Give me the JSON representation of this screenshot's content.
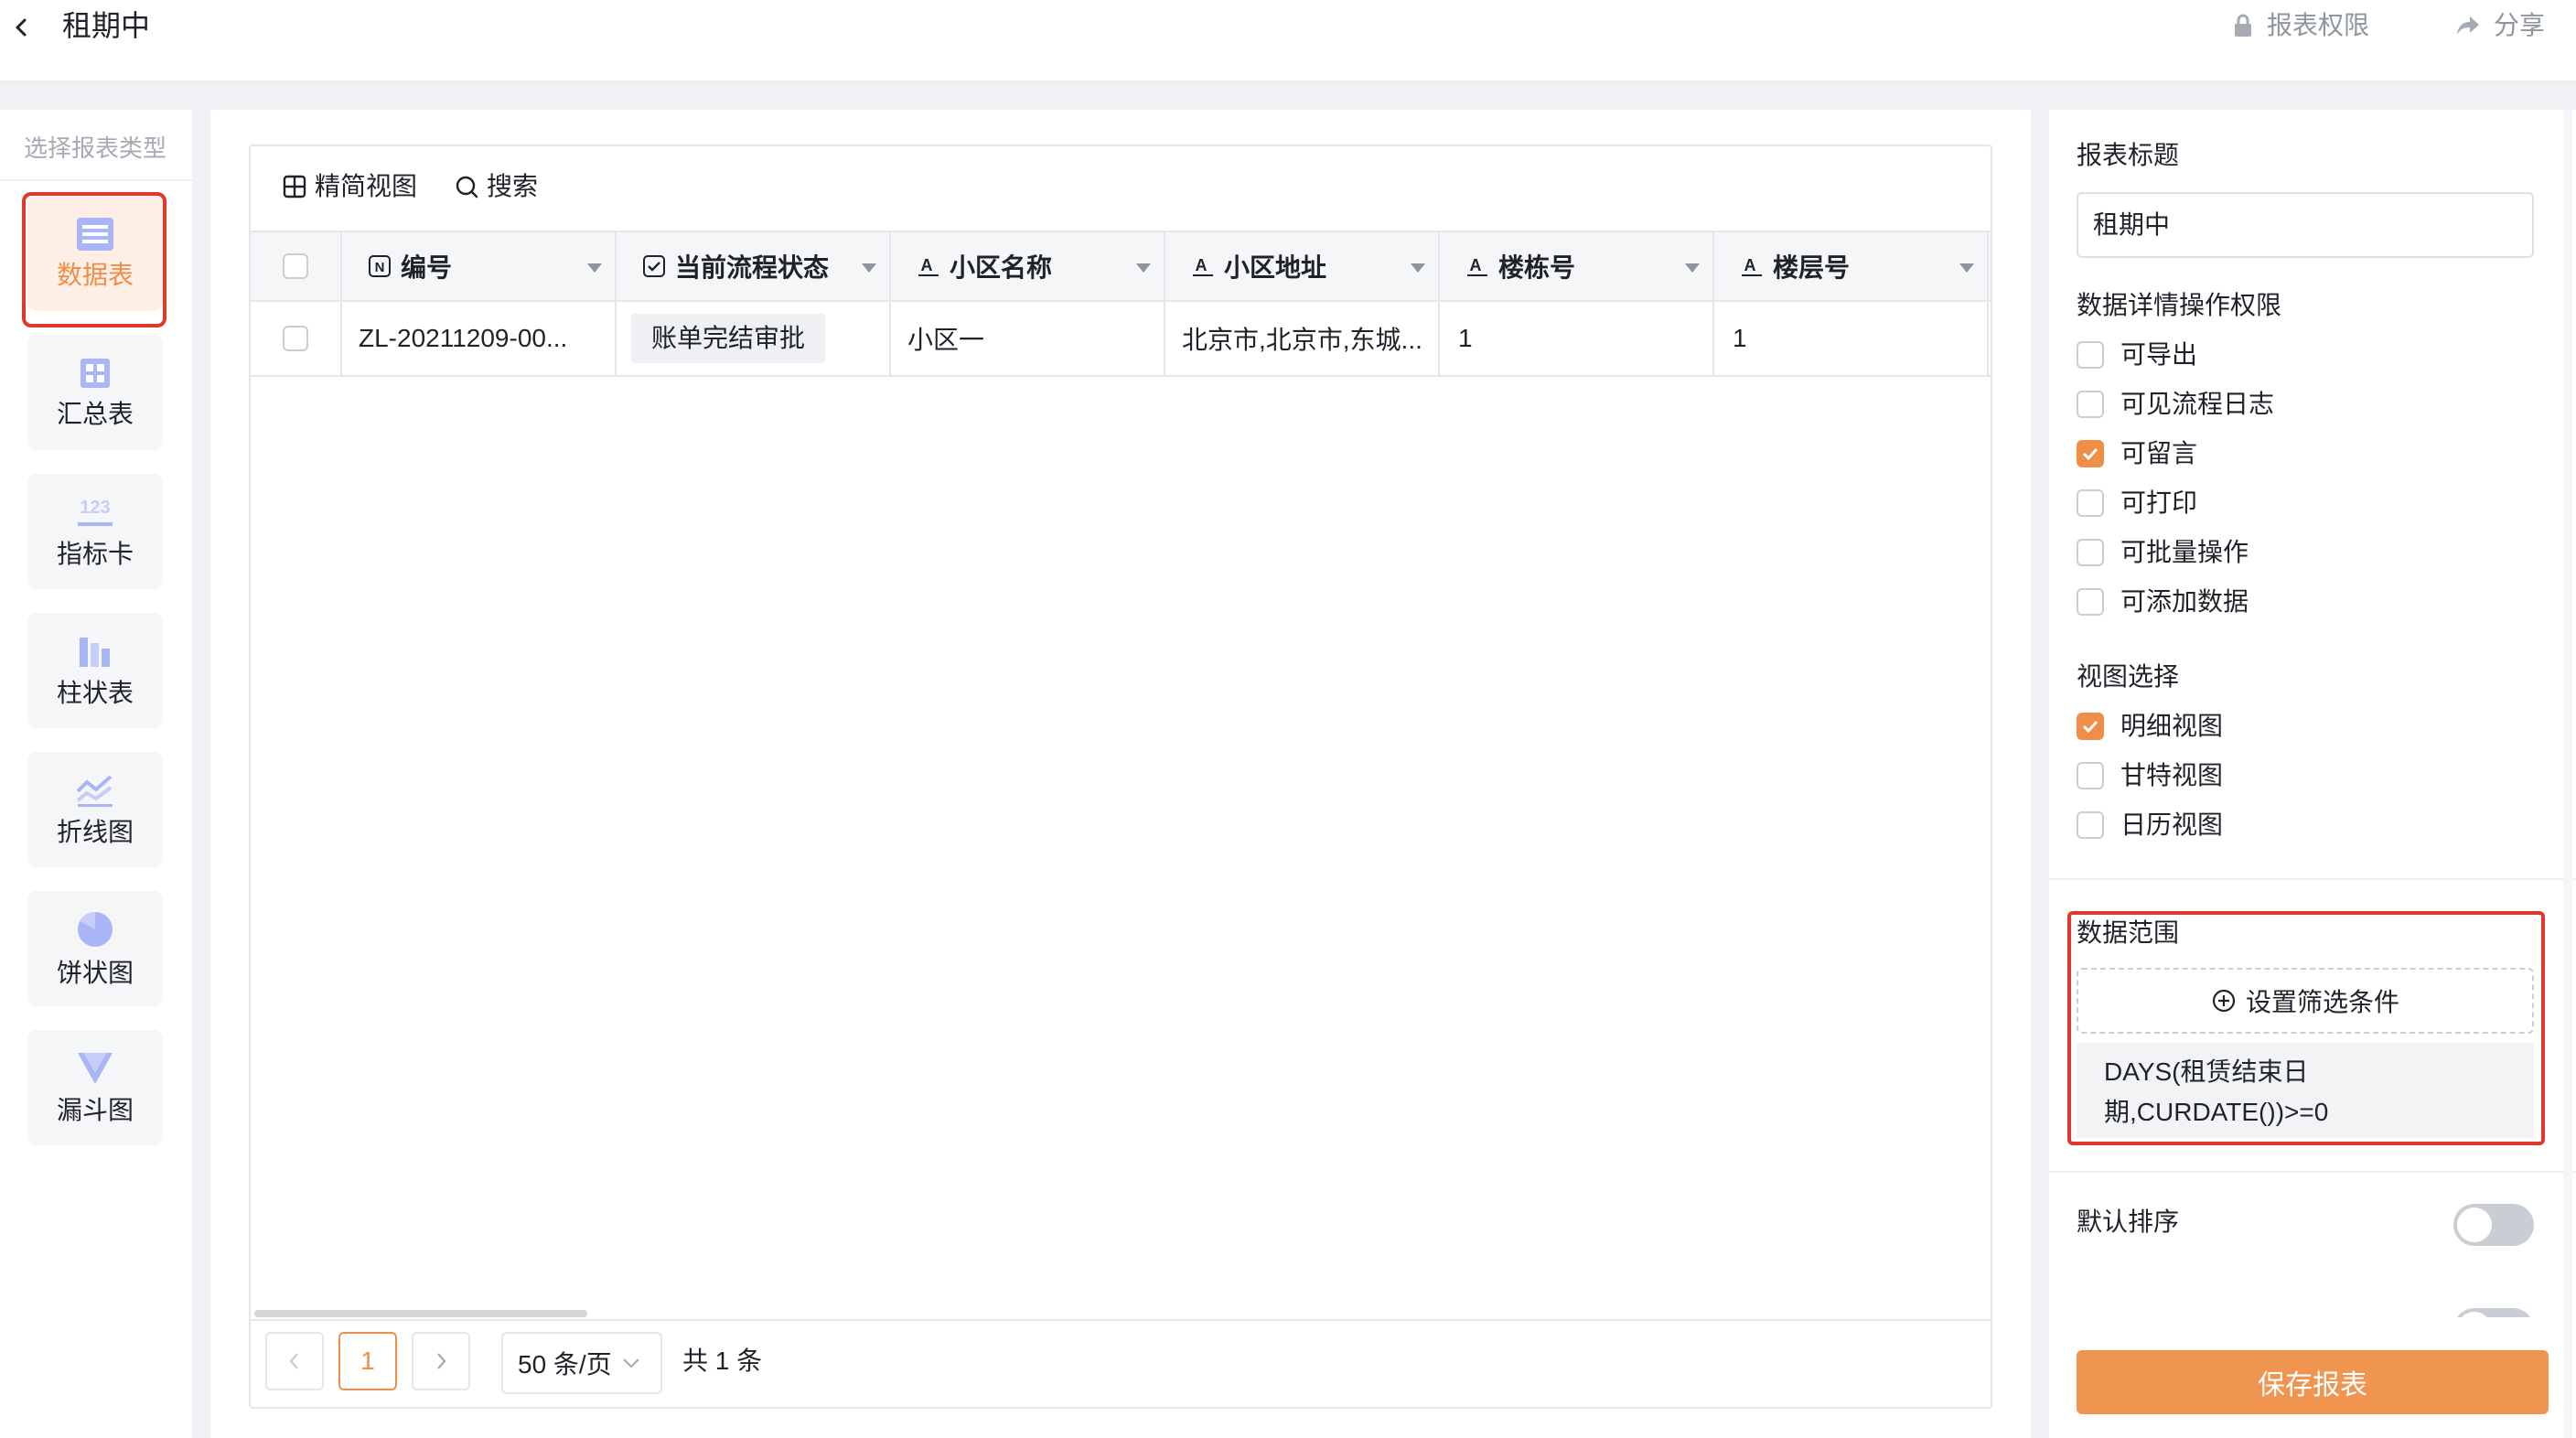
{
  "header": {
    "title": "租期中",
    "permission_label": "报表权限",
    "share_label": "分享"
  },
  "left_panel": {
    "title": "选择报表类型",
    "types": [
      {
        "label": "数据表",
        "icon": "table-icon",
        "active": true
      },
      {
        "label": "汇总表",
        "icon": "summary-table-icon",
        "active": false
      },
      {
        "label": "指标卡",
        "icon": "metric-card-icon",
        "active": false
      },
      {
        "label": "柱状表",
        "icon": "bar-chart-icon",
        "active": false
      },
      {
        "label": "折线图",
        "icon": "line-chart-icon",
        "active": false
      },
      {
        "label": "饼状图",
        "icon": "pie-chart-icon",
        "active": false
      },
      {
        "label": "漏斗图",
        "icon": "funnel-chart-icon",
        "active": false
      }
    ]
  },
  "toolbar": {
    "compact_view_label": "精简视图",
    "search_label": "搜索"
  },
  "table": {
    "columns": [
      {
        "label": "编号",
        "icon": "number-field-icon"
      },
      {
        "label": "当前流程状态",
        "icon": "checkbox-field-icon"
      },
      {
        "label": "小区名称",
        "icon": "text-field-icon"
      },
      {
        "label": "小区地址",
        "icon": "text-field-icon"
      },
      {
        "label": "楼栋号",
        "icon": "text-field-icon"
      },
      {
        "label": "楼层号",
        "icon": "text-field-icon"
      }
    ],
    "rows": [
      {
        "id": "ZL-20211209-00...",
        "status": "账单完结审批",
        "community": "小区一",
        "address": "北京市,北京市,东城...",
        "building": "1",
        "floor": "1"
      }
    ]
  },
  "pagination": {
    "current_page": "1",
    "page_size": "50 条/页",
    "total": "共 1 条"
  },
  "settings": {
    "report_title_label": "报表标题",
    "report_title_value": "租期中",
    "permissions_label": "数据详情操作权限",
    "permissions": [
      {
        "label": "可导出",
        "checked": false
      },
      {
        "label": "可见流程日志",
        "checked": false
      },
      {
        "label": "可留言",
        "checked": true
      },
      {
        "label": "可打印",
        "checked": false
      },
      {
        "label": "可批量操作",
        "checked": false
      },
      {
        "label": "可添加数据",
        "checked": false
      }
    ],
    "view_label": "视图选择",
    "views": [
      {
        "label": "明细视图",
        "checked": true
      },
      {
        "label": "甘特视图",
        "checked": false
      },
      {
        "label": "日历视图",
        "checked": false
      }
    ],
    "data_range_label": "数据范围",
    "set_filter_label": "设置筛选条件",
    "filter_formula_line1": "DAYS(租赁结束日",
    "filter_formula_line2": "期,CURDATE())>=0",
    "default_sort_label": "默认排序",
    "default_sort_on": false,
    "query_condition_on": false,
    "save_label": "保存报表"
  },
  "colors": {
    "accent": "#ef954f",
    "highlight_border": "#e0392b",
    "icon_blue": "#a9b5f5"
  }
}
